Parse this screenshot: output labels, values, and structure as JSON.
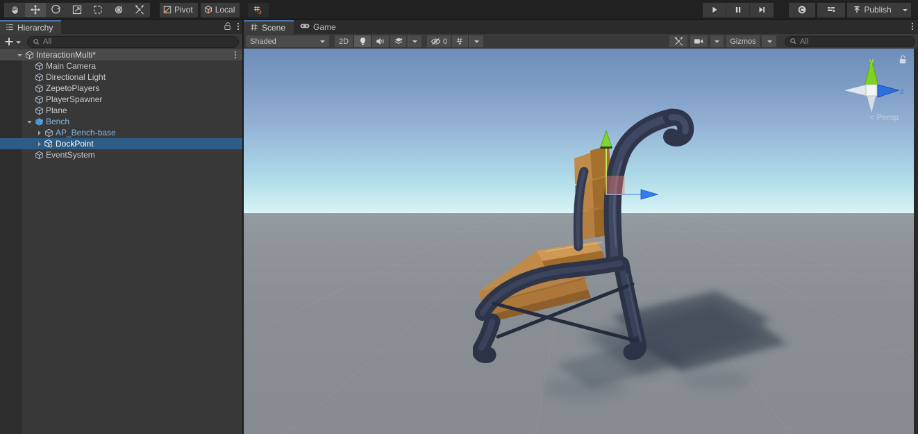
{
  "toolbar": {
    "tools": [
      {
        "name": "hand-tool",
        "icon": "hand",
        "active": false
      },
      {
        "name": "move-tool",
        "icon": "move",
        "active": true
      },
      {
        "name": "rotate-tool",
        "icon": "rotate",
        "active": false
      },
      {
        "name": "scale-tool",
        "icon": "scale",
        "active": false
      },
      {
        "name": "rect-tool",
        "icon": "rect",
        "active": false
      },
      {
        "name": "transform-tool",
        "icon": "transform",
        "active": false
      },
      {
        "name": "custom-tool",
        "icon": "wrench",
        "active": false
      }
    ],
    "pivot_label": "Pivot",
    "handle_label": "Local",
    "snap_label": "",
    "play_label": "",
    "pause_label": "",
    "step_label": "",
    "publish_label": "Publish",
    "cloud_label": "",
    "layers_label": ""
  },
  "hierarchy": {
    "tab_label": "Hierarchy",
    "add_label": "",
    "search_placeholder": "All",
    "rows": [
      {
        "label": "InteractionMulti*",
        "depth": 0,
        "icon": "scene",
        "type": "scene",
        "expanded": true,
        "selected": false,
        "kebab": true
      },
      {
        "label": "Main Camera",
        "depth": 1,
        "icon": "gameobject",
        "type": "normal",
        "expanded": null,
        "selected": false,
        "kebab": false
      },
      {
        "label": "Directional Light",
        "depth": 1,
        "icon": "gameobject",
        "type": "normal",
        "expanded": null,
        "selected": false,
        "kebab": false
      },
      {
        "label": "ZepetoPlayers",
        "depth": 1,
        "icon": "gameobject",
        "type": "normal",
        "expanded": null,
        "selected": false,
        "kebab": false
      },
      {
        "label": "PlayerSpawner",
        "depth": 1,
        "icon": "gameobject",
        "type": "normal",
        "expanded": null,
        "selected": false,
        "kebab": false
      },
      {
        "label": "Plane",
        "depth": 1,
        "icon": "gameobject",
        "type": "normal",
        "expanded": null,
        "selected": false,
        "kebab": false
      },
      {
        "label": "Bench",
        "depth": 1,
        "icon": "prefab",
        "type": "prefab",
        "expanded": true,
        "selected": false,
        "kebab": false
      },
      {
        "label": "AP_Bench-base",
        "depth": 2,
        "icon": "gameobject",
        "type": "prefab",
        "expanded": false,
        "selected": false,
        "kebab": false
      },
      {
        "label": "DockPoint",
        "depth": 2,
        "icon": "prefab-variant",
        "type": "prefab",
        "expanded": false,
        "selected": true,
        "kebab": false
      },
      {
        "label": "EventSystem",
        "depth": 1,
        "icon": "gameobject",
        "type": "normal",
        "expanded": null,
        "selected": false,
        "kebab": false
      }
    ]
  },
  "scene": {
    "tabs": [
      {
        "label": "Scene",
        "icon": "grid-icon",
        "active": true
      },
      {
        "label": "Game",
        "icon": "gamepad-icon",
        "active": false
      }
    ],
    "draw_mode": "Shaded",
    "mode_2d": "2D",
    "lighting_label": "",
    "audio_label": "",
    "fx_label": "",
    "hidden_count": "0",
    "grid_label": "",
    "gizmos_label": "Gizmos",
    "search_placeholder": "All",
    "view_gizmo": {
      "axis_y": "y",
      "axis_z": "z",
      "projection": "Persp"
    },
    "colors": {
      "sky_top": "#6d8dba",
      "sky_horizon": "#dff6f7",
      "ground": "#8b9196",
      "frame": "#3a4053",
      "wood": "#c08a4a",
      "gizmo_y": "#7fd632",
      "gizmo_z": "#2f7ff0",
      "gizmo_x_plane": "#e0786e",
      "selected_row": "#2c5d87",
      "prefab_text": "#7fb8e8"
    }
  }
}
